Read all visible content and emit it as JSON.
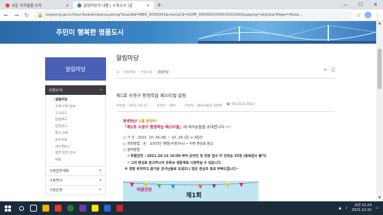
{
  "browser": {
    "tabs": [
      {
        "label": "쉬운 우리말을 쓰자",
        "active": false
      },
      {
        "label": "알림마당의 내용 | 수영소식 (알",
        "active": true
      }
    ],
    "address": "suyeong.go.kr/tour/board/view.suyeong?boardId=BBS_0000001&menuCd=DOM_000000103001001000&paging=ok&startPage=4&da..."
  },
  "banner": {
    "slogan": "주민이 행복한 명품도시"
  },
  "sidebar": {
    "hero_title": "알림마당",
    "section_title": "수영소식",
    "items": [
      {
        "label": "알림마당",
        "active": true
      },
      {
        "label": "코로나19 정보",
        "active": false
      },
      {
        "label": "고시공고",
        "active": false
      },
      {
        "label": "입법예고",
        "active": false
      },
      {
        "label": "입찰공고",
        "active": false
      },
      {
        "label": "행사·교육",
        "active": false
      },
      {
        "label": "보도자료",
        "active": false
      },
      {
        "label": "새수영뉴스",
        "active": false
      },
      {
        "label": "정부 정책 안내",
        "active": false
      },
      {
        "label": "채용",
        "active": false
      }
    ],
    "groups": [
      {
        "label": "구정업무계획"
      },
      {
        "label": "구정백서"
      },
      {
        "label": "구정운영"
      }
    ]
  },
  "main": {
    "page_title": "알림마당",
    "breadcrumbs": [
      "알림마당",
      "수영소식",
      "알림마당"
    ],
    "post_title": "제1회 수영구 평생학습 페스티벌 알림",
    "meta": {
      "date": "작성일 : 2021-10-17",
      "views": "조회수 : 164",
      "author": "작성자 : 평생교육과 김명옥",
      "phone": "☎ 051-610-3922"
    },
    "body": {
      "line1_a": "평생학습! ",
      "line1_b": "나를 찾아라!",
      "line2_a": "「제1회 수영구 평생학습 페스티벌」",
      "line2_b": "에 여러분들을 초대합니다~!!",
      "period": "○ 기    간 : 2021. 10. 26.(화) ~ 10. 29.(금) + 4일간",
      "method": "○ 개최방법 : 온 · 오프라인 병행(수영구tv) • 아래 편성표 참고",
      "participation": "○ 참여방법",
      "p1": "• 특별강연 : 2021.10.14 10:00 부터 온라인 및 전화 접수 각 선착순 35명 (중복접수 불가)",
      "p2": "• 그외 편성표 참고하시어 유튜브 생중계로 시청하실 수 있습니다.",
      "note": "※ 정말 유익하고 즐거운 강사님들로 모셨으니 많은 관심과 홍보 부탁드립니다~"
    },
    "poster_text": "제1회",
    "poster_badge": "마음건강"
  },
  "taskbar": {
    "time": "오전 12:24",
    "date": "2021-12-10",
    "app_colors": [
      "#f0b400",
      "#e23a2c",
      "#2e7d32",
      "#6b3fa0",
      "#f7e600",
      "#1f6fd1",
      "#c62828"
    ]
  }
}
